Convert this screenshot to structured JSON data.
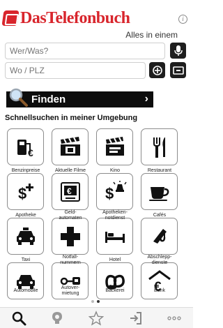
{
  "header": {
    "brand": "DasTelefonbuch",
    "tagline": "Alles in einem",
    "info_icon": "info-icon"
  },
  "search": {
    "what_placeholder": "Wer/Was?",
    "where_placeholder": "Wo / PLZ",
    "find_label": "Finden"
  },
  "nearby": {
    "title": "Schnellsuchen in meiner Umgebung",
    "tiles": [
      {
        "label": "Benzinpreise",
        "icon": "fuel-price-icon"
      },
      {
        "label": "Aktuelle Filme",
        "icon": "film-clapper-icon"
      },
      {
        "label": "Kino",
        "icon": "cinema-clapper-icon"
      },
      {
        "label": "Restaurant",
        "icon": "cutlery-icon"
      },
      {
        "label": "Apotheke",
        "icon": "pharmacy-icon"
      },
      {
        "label": "Geld-\nautomaten",
        "icon": "atm-icon"
      },
      {
        "label": "Apotheken-\nnotdienst",
        "icon": "emergency-pharmacy-icon"
      },
      {
        "label": "Cafés",
        "icon": "coffee-cup-icon"
      },
      {
        "label": "Taxi",
        "icon": "taxi-icon"
      },
      {
        "label": "Notfall-\nnummern",
        "icon": "emergency-cross-icon"
      },
      {
        "label": "Hotel",
        "icon": "bed-icon"
      },
      {
        "label": "Abschlepp-\ndienste",
        "icon": "tow-hook-icon"
      },
      {
        "label": "Automobile",
        "icon": "car-icon"
      },
      {
        "label": "Autover-\nmietung",
        "icon": "car-rental-key-icon"
      },
      {
        "label": "Bäckerei",
        "icon": "pretzel-icon"
      },
      {
        "label": "Bank",
        "icon": "euro-bank-icon"
      }
    ]
  },
  "pagination": {
    "pages": 2,
    "current": 2
  },
  "tabbar": {
    "tabs": [
      {
        "icon": "search-tab-icon"
      },
      {
        "icon": "tips-tab-icon"
      },
      {
        "icon": "favorites-star-icon"
      },
      {
        "icon": "login-tab-icon"
      },
      {
        "icon": "more-dots-icon"
      }
    ]
  },
  "colors": {
    "brand": "#d8252c",
    "dark": "#1e1e1e"
  }
}
